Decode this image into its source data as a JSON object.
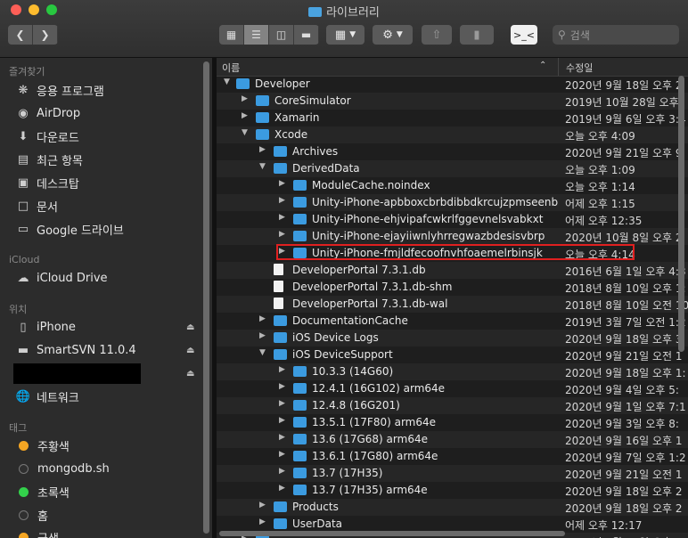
{
  "window": {
    "title": "라이브러리"
  },
  "toolbar": {
    "back_icon": "chevron-left-icon",
    "forward_icon": "chevron-right-icon",
    "view_icons": [
      "icon-view-icon",
      "list-view-icon",
      "column-view-icon",
      "gallery-view-icon"
    ],
    "search_placeholder": "검색"
  },
  "sidebar": {
    "favorites_label": "즐겨찾기",
    "favorites": [
      {
        "label": "응용 프로그램",
        "icon": "applications-icon"
      },
      {
        "label": "AirDrop",
        "icon": "airdrop-icon"
      },
      {
        "label": "다운로드",
        "icon": "downloads-icon"
      },
      {
        "label": "최근 항목",
        "icon": "recents-icon"
      },
      {
        "label": "데스크탑",
        "icon": "desktop-icon"
      },
      {
        "label": "문서",
        "icon": "document-icon"
      },
      {
        "label": "Google 드라이브",
        "icon": "folder-icon"
      }
    ],
    "icloud_label": "iCloud",
    "icloud": [
      {
        "label": "iCloud Drive",
        "icon": "cloud-icon"
      }
    ],
    "locations_label": "위치",
    "locations": [
      {
        "label": "iPhone",
        "icon": "phone-icon"
      },
      {
        "label": "SmartSVN 11.0.4",
        "icon": "disk-icon"
      },
      {
        "label": "",
        "icon": "disk-icon"
      },
      {
        "label": "네트워크",
        "icon": "network-icon"
      }
    ],
    "tags_label": "태그",
    "tags": [
      {
        "label": "주황색",
        "color": "#f5a623"
      },
      {
        "label": "mongodb.sh",
        "color": "#2f2f2f"
      },
      {
        "label": "초록색",
        "color": "#33d14b"
      },
      {
        "label": "홈",
        "color": "#2f2f2f"
      },
      {
        "label": "금색",
        "color": "#f5a623"
      }
    ]
  },
  "list": {
    "col_name": "이름",
    "col_date": "수정일",
    "rows": [
      {
        "depth": 0,
        "expand": "open",
        "type": "folder",
        "name": "Developer",
        "date": "2020년 9월 18일 오후 2"
      },
      {
        "depth": 1,
        "expand": "closed",
        "type": "folder",
        "name": "CoreSimulator",
        "date": "2019년 10월 28일 오후"
      },
      {
        "depth": 1,
        "expand": "closed",
        "type": "folder",
        "name": "Xamarin",
        "date": "2019년 9월 6일 오후 3:4"
      },
      {
        "depth": 1,
        "expand": "open",
        "type": "folder",
        "name": "Xcode",
        "date": "오늘 오후 4:09"
      },
      {
        "depth": 2,
        "expand": "closed",
        "type": "folder",
        "name": "Archives",
        "date": "2020년 9월 21일 오후 9"
      },
      {
        "depth": 2,
        "expand": "open",
        "type": "folder",
        "name": "DerivedData",
        "date": "오늘 오후 1:09"
      },
      {
        "depth": 3,
        "expand": "closed",
        "type": "folder",
        "name": "ModuleCache.noindex",
        "date": "오늘 오후 1:14"
      },
      {
        "depth": 3,
        "expand": "closed",
        "type": "folder",
        "name": "Unity-iPhone-apbboxcbrbdibbdkrcujzpmseenb",
        "date": "어제 오후 1:15"
      },
      {
        "depth": 3,
        "expand": "closed",
        "type": "folder",
        "name": "Unity-iPhone-ehjvipafcwkrlfggevnelsvabkxt",
        "date": "어제 오후 12:35"
      },
      {
        "depth": 3,
        "expand": "closed",
        "type": "folder",
        "name": "Unity-iPhone-ejayiiwnlyhrregwazbdesisvbrp",
        "date": "2020년 10월 8일 오후 2"
      },
      {
        "depth": 3,
        "expand": "closed",
        "type": "folder",
        "name": "Unity-iPhone-fmjldfecoofnvhfoaemelrbinsjk",
        "date": "오늘 오후 4:14"
      },
      {
        "depth": 2,
        "expand": "none",
        "type": "doc",
        "name": "DeveloperPortal 7.3.1.db",
        "date": "2016년 6월 1일 오후 4:3"
      },
      {
        "depth": 2,
        "expand": "none",
        "type": "doc",
        "name": "DeveloperPortal 7.3.1.db-shm",
        "date": "2018년 8월 10일 오후 1:"
      },
      {
        "depth": 2,
        "expand": "none",
        "type": "doc",
        "name": "DeveloperPortal 7.3.1.db-wal",
        "date": "2018년 8월 10일 오전 10"
      },
      {
        "depth": 2,
        "expand": "closed",
        "type": "folder",
        "name": "DocumentationCache",
        "date": "2019년 3월 7일 오전 1:2"
      },
      {
        "depth": 2,
        "expand": "closed",
        "type": "folder",
        "name": "iOS Device Logs",
        "date": "2020년 9월 18일 오후 3"
      },
      {
        "depth": 2,
        "expand": "open",
        "type": "folder",
        "name": "iOS DeviceSupport",
        "date": "2020년 9월 21일 오전 1"
      },
      {
        "depth": 3,
        "expand": "closed",
        "type": "folder",
        "name": "10.3.3 (14G60)",
        "date": "2020년 9월 18일 오후 1:"
      },
      {
        "depth": 3,
        "expand": "closed",
        "type": "folder",
        "name": "12.4.1 (16G102) arm64e",
        "date": "2020년 9월 4일 오후 5:"
      },
      {
        "depth": 3,
        "expand": "closed",
        "type": "folder",
        "name": "12.4.8 (16G201)",
        "date": "2020년 9월 1일 오후 7:1"
      },
      {
        "depth": 3,
        "expand": "closed",
        "type": "folder",
        "name": "13.5.1 (17F80) arm64e",
        "date": "2020년 9월 3일 오후 8:"
      },
      {
        "depth": 3,
        "expand": "closed",
        "type": "folder",
        "name": "13.6 (17G68) arm64e",
        "date": "2020년 9월 16일 오후 1"
      },
      {
        "depth": 3,
        "expand": "closed",
        "type": "folder",
        "name": "13.6.1 (17G80) arm64e",
        "date": "2020년 9월 7일 오후 1:2"
      },
      {
        "depth": 3,
        "expand": "closed",
        "type": "folder",
        "name": "13.7 (17H35)",
        "date": "2020년 9월 21일 오전 1"
      },
      {
        "depth": 3,
        "expand": "closed",
        "type": "folder",
        "name": "13.7 (17H35) arm64e",
        "date": "2020년 9월 18일 오후 2"
      },
      {
        "depth": 2,
        "expand": "closed",
        "type": "folder",
        "name": "Products",
        "date": "2020년 9월 18일 오후 2"
      },
      {
        "depth": 2,
        "expand": "closed",
        "type": "folder",
        "name": "UserData",
        "date": "어제 오후 12:17"
      },
      {
        "depth": 1,
        "expand": "closed",
        "type": "folder",
        "name": "",
        "date": "2020년 9월 18일 오후 1"
      }
    ]
  }
}
